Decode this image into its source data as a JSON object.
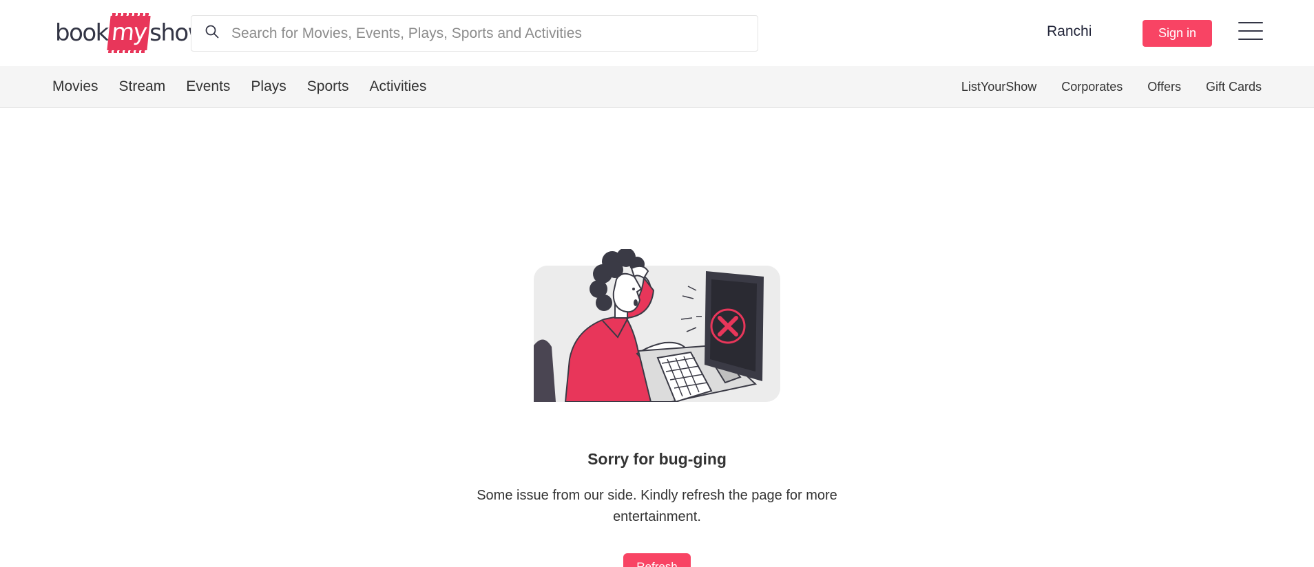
{
  "header": {
    "logo": {
      "part1": "book",
      "part2": "my",
      "part3": "show"
    },
    "search": {
      "placeholder": "Search for Movies, Events, Plays, Sports and Activities",
      "icon": "search-icon"
    },
    "city": "Ranchi",
    "signin_label": "Sign in",
    "menu_icon": "hamburger-menu-icon"
  },
  "nav": {
    "left": [
      "Movies",
      "Stream",
      "Events",
      "Plays",
      "Sports",
      "Activities"
    ],
    "right": [
      "ListYourShow",
      "Corporates",
      "Offers",
      "Gift Cards"
    ]
  },
  "error": {
    "illustration": "frustrated-person-at-computer-illustration",
    "title": "Sorry for bug-ging",
    "message": "Some issue from our side. Kindly refresh the page for more entertainment.",
    "refresh_label": "Refresh"
  },
  "colors": {
    "accent": "#f84464",
    "brand": "#e8365a",
    "text": "#333333",
    "navbar_bg": "#f5f5f5"
  }
}
